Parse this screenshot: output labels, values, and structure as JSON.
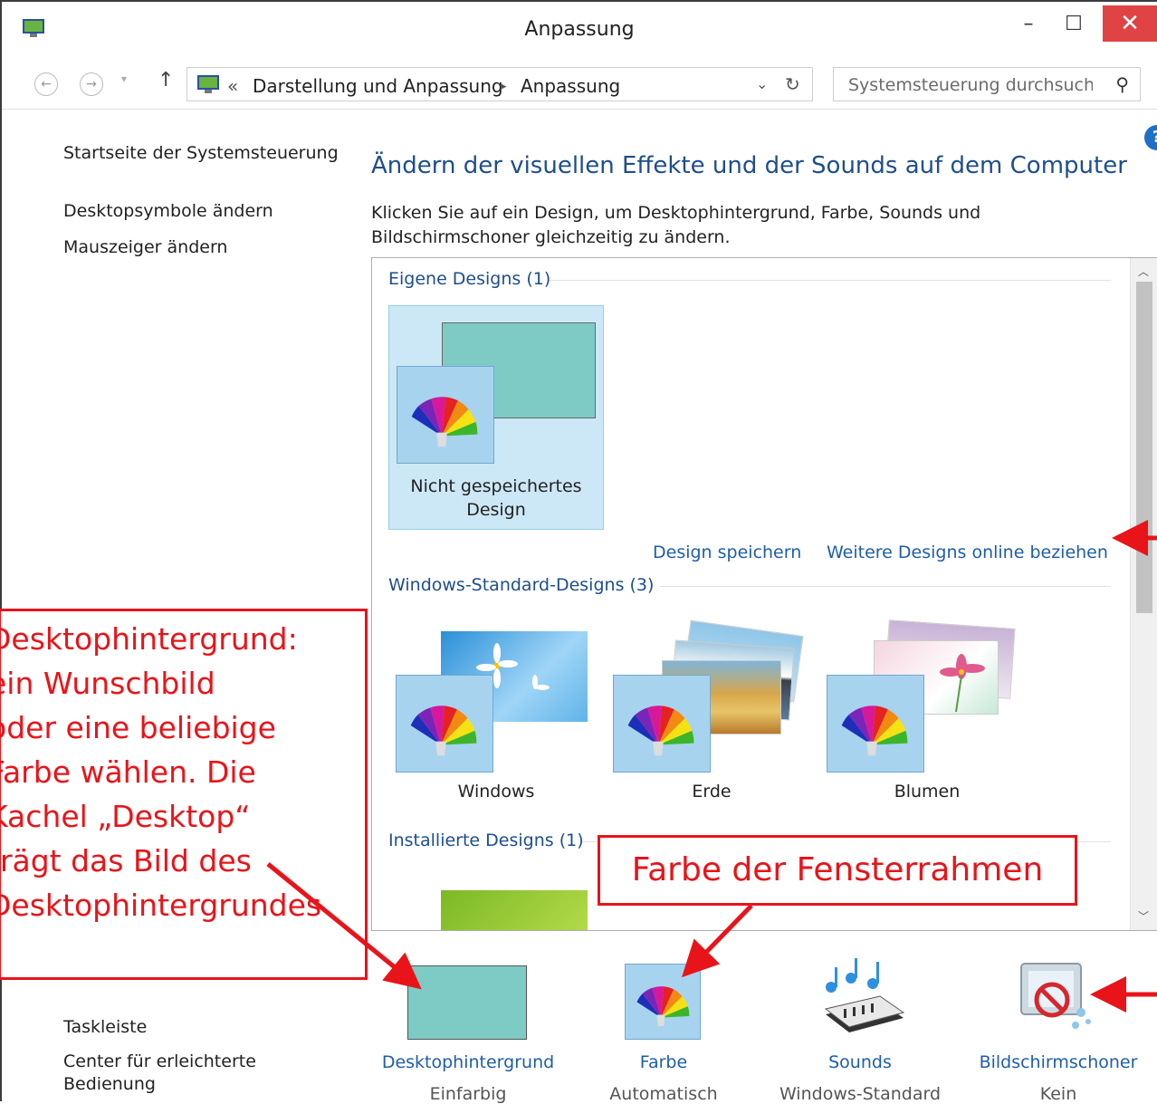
{
  "window": {
    "title": "Anpassung",
    "controls": {
      "minimize": "–",
      "maximize": "☐",
      "close": "✕"
    }
  },
  "address_bar": {
    "prefix": "«",
    "breadcrumbs": [
      "Darstellung und Anpassung",
      "Anpassung"
    ],
    "separator": "▸",
    "search_placeholder": "Systemsteuerung durchsuchen"
  },
  "help_label": "?",
  "left_nav": {
    "top_links": [
      "Startseite der Systemsteuerung",
      "Desktopsymbole ändern",
      "Mauszeiger ändern"
    ],
    "bottom_links": [
      "Taskleiste",
      "Center für erleichterte",
      "Bedienung"
    ]
  },
  "main": {
    "heading": "Ändern der visuellen Effekte und der Sounds auf dem Computer",
    "description": "Klicken Sie auf ein Design, um Desktophintergrund, Farbe, Sounds und Bildschirmschoner gleichzeitig zu ändern.",
    "groups": [
      {
        "title": "Eigene Designs (1)",
        "items": [
          "Nicht gespeichertes Design"
        ]
      },
      {
        "title": "Windows-Standard-Designs (3)",
        "items": [
          "Windows",
          "Erde",
          "Blumen"
        ]
      },
      {
        "title": "Installierte Designs (1)",
        "items": []
      }
    ],
    "unsaved_line1": "Nicht gespeichertes",
    "unsaved_line2": "Design",
    "links": {
      "save": "Design speichern",
      "more_online": "Weitere Designs online beziehen"
    }
  },
  "bottom": [
    {
      "label": "Desktophintergrund",
      "value": "Einfarbig"
    },
    {
      "label": "Farbe",
      "value": "Automatisch"
    },
    {
      "label": "Sounds",
      "value": "Windows-Standard"
    },
    {
      "label": "Bildschirmschoner",
      "value": "Kein"
    }
  ],
  "annotations": {
    "left_lines": [
      "Desktophintergrund:",
      "ein Wunschbild",
      "oder eine beliebige",
      "Farbe wählen. Die",
      "Kachel „Desktop“",
      "trägt das Bild des",
      "Desktophintergrundes"
    ],
    "mid": "Farbe der Fensterrahmen"
  },
  "colors": {
    "accent_link": "#1e5ea8",
    "heading": "#1e4e8c",
    "annotation_red": "#e8141a",
    "solid_bg": "#7ecbc5",
    "selection": "#cce8f6",
    "close_red": "#e04343"
  }
}
